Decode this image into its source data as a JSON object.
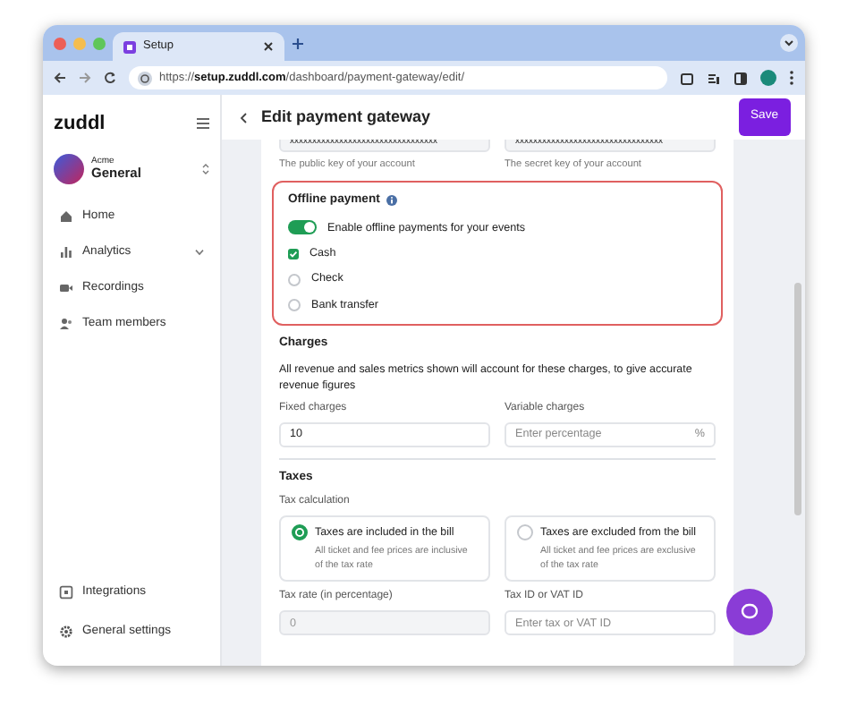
{
  "browser": {
    "tab_title": "Setup",
    "url": "https://**setup.zuddl.com**/dashboard/payment-gateway/edit/"
  },
  "sidebar": {
    "logo": "zuddl",
    "org_label": "Acme",
    "org_name": "General",
    "items": [
      {
        "label": "Home"
      },
      {
        "label": "Analytics",
        "expanded": false
      },
      {
        "label": "Recordings"
      },
      {
        "label": "Team members"
      }
    ],
    "footer_items": [
      {
        "label": "Integrations"
      },
      {
        "label": "General settings"
      }
    ]
  },
  "header": {
    "title": "Edit payment gateway",
    "save": "Save"
  },
  "keys": [
    {
      "value": "xxxxxxxxxxxxxxxxxxxxxxxxxxxxxxxxx",
      "hint": "The public key of your account"
    },
    {
      "value": "xxxxxxxxxxxxxxxxxxxxxxxxxxxxxxxxx",
      "hint": "The secret key of your account"
    }
  ],
  "offline": {
    "title": "Offline payment",
    "toggle": {
      "label": "Enable offline payments for your events",
      "on": true
    },
    "options": [
      {
        "label": "Cash",
        "checked": true
      },
      {
        "label": "Check",
        "checked": false
      },
      {
        "label": "Bank transfer",
        "checked": false
      }
    ]
  },
  "charges": {
    "title": "Charges",
    "description": "All revenue and sales metrics shown will account for these charges, to give accurate revenue figures",
    "fields": [
      {
        "label": "Fixed charges",
        "value": "10"
      },
      {
        "label": "Variable charges",
        "placeholder": "Enter percentage",
        "suffix": "%"
      }
    ]
  },
  "taxes": {
    "title": "Taxes",
    "calc_label": "Tax calculation",
    "options": [
      {
        "title": "Taxes are included in the bill",
        "description": "All ticket and fee prices are inclusive of the tax rate",
        "selected": true
      },
      {
        "title": "Taxes are excluded from the bill",
        "description": "All ticket and fee prices are exclusive of the tax rate",
        "selected": false
      }
    ],
    "fields": [
      {
        "label": "Tax rate (in percentage)",
        "value": "0",
        "disabled": true
      },
      {
        "label": "Tax ID or VAT ID",
        "placeholder": "Enter tax or VAT ID"
      }
    ]
  }
}
